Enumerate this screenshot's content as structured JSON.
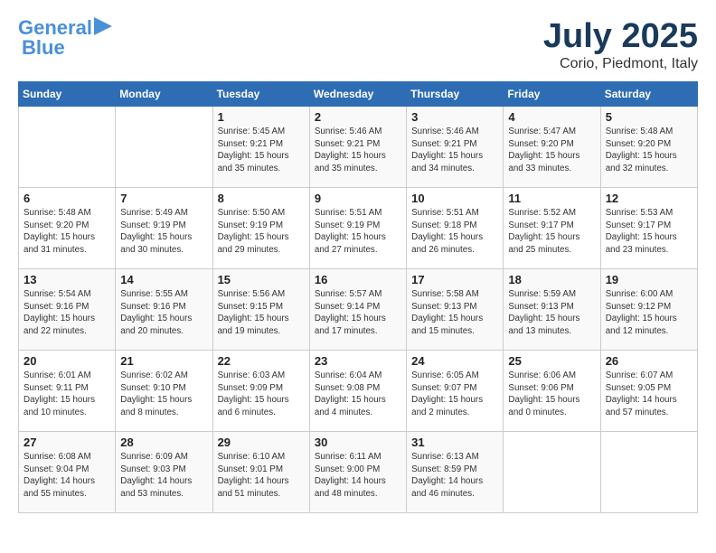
{
  "header": {
    "logo_line1": "General",
    "logo_line2": "Blue",
    "month_title": "July 2025",
    "location": "Corio, Piedmont, Italy"
  },
  "weekdays": [
    "Sunday",
    "Monday",
    "Tuesday",
    "Wednesday",
    "Thursday",
    "Friday",
    "Saturday"
  ],
  "weeks": [
    [
      {
        "day": "",
        "info": ""
      },
      {
        "day": "",
        "info": ""
      },
      {
        "day": "1",
        "info": "Sunrise: 5:45 AM\nSunset: 9:21 PM\nDaylight: 15 hours and 35 minutes."
      },
      {
        "day": "2",
        "info": "Sunrise: 5:46 AM\nSunset: 9:21 PM\nDaylight: 15 hours and 35 minutes."
      },
      {
        "day": "3",
        "info": "Sunrise: 5:46 AM\nSunset: 9:21 PM\nDaylight: 15 hours and 34 minutes."
      },
      {
        "day": "4",
        "info": "Sunrise: 5:47 AM\nSunset: 9:20 PM\nDaylight: 15 hours and 33 minutes."
      },
      {
        "day": "5",
        "info": "Sunrise: 5:48 AM\nSunset: 9:20 PM\nDaylight: 15 hours and 32 minutes."
      }
    ],
    [
      {
        "day": "6",
        "info": "Sunrise: 5:48 AM\nSunset: 9:20 PM\nDaylight: 15 hours and 31 minutes."
      },
      {
        "day": "7",
        "info": "Sunrise: 5:49 AM\nSunset: 9:19 PM\nDaylight: 15 hours and 30 minutes."
      },
      {
        "day": "8",
        "info": "Sunrise: 5:50 AM\nSunset: 9:19 PM\nDaylight: 15 hours and 29 minutes."
      },
      {
        "day": "9",
        "info": "Sunrise: 5:51 AM\nSunset: 9:19 PM\nDaylight: 15 hours and 27 minutes."
      },
      {
        "day": "10",
        "info": "Sunrise: 5:51 AM\nSunset: 9:18 PM\nDaylight: 15 hours and 26 minutes."
      },
      {
        "day": "11",
        "info": "Sunrise: 5:52 AM\nSunset: 9:17 PM\nDaylight: 15 hours and 25 minutes."
      },
      {
        "day": "12",
        "info": "Sunrise: 5:53 AM\nSunset: 9:17 PM\nDaylight: 15 hours and 23 minutes."
      }
    ],
    [
      {
        "day": "13",
        "info": "Sunrise: 5:54 AM\nSunset: 9:16 PM\nDaylight: 15 hours and 22 minutes."
      },
      {
        "day": "14",
        "info": "Sunrise: 5:55 AM\nSunset: 9:16 PM\nDaylight: 15 hours and 20 minutes."
      },
      {
        "day": "15",
        "info": "Sunrise: 5:56 AM\nSunset: 9:15 PM\nDaylight: 15 hours and 19 minutes."
      },
      {
        "day": "16",
        "info": "Sunrise: 5:57 AM\nSunset: 9:14 PM\nDaylight: 15 hours and 17 minutes."
      },
      {
        "day": "17",
        "info": "Sunrise: 5:58 AM\nSunset: 9:13 PM\nDaylight: 15 hours and 15 minutes."
      },
      {
        "day": "18",
        "info": "Sunrise: 5:59 AM\nSunset: 9:13 PM\nDaylight: 15 hours and 13 minutes."
      },
      {
        "day": "19",
        "info": "Sunrise: 6:00 AM\nSunset: 9:12 PM\nDaylight: 15 hours and 12 minutes."
      }
    ],
    [
      {
        "day": "20",
        "info": "Sunrise: 6:01 AM\nSunset: 9:11 PM\nDaylight: 15 hours and 10 minutes."
      },
      {
        "day": "21",
        "info": "Sunrise: 6:02 AM\nSunset: 9:10 PM\nDaylight: 15 hours and 8 minutes."
      },
      {
        "day": "22",
        "info": "Sunrise: 6:03 AM\nSunset: 9:09 PM\nDaylight: 15 hours and 6 minutes."
      },
      {
        "day": "23",
        "info": "Sunrise: 6:04 AM\nSunset: 9:08 PM\nDaylight: 15 hours and 4 minutes."
      },
      {
        "day": "24",
        "info": "Sunrise: 6:05 AM\nSunset: 9:07 PM\nDaylight: 15 hours and 2 minutes."
      },
      {
        "day": "25",
        "info": "Sunrise: 6:06 AM\nSunset: 9:06 PM\nDaylight: 15 hours and 0 minutes."
      },
      {
        "day": "26",
        "info": "Sunrise: 6:07 AM\nSunset: 9:05 PM\nDaylight: 14 hours and 57 minutes."
      }
    ],
    [
      {
        "day": "27",
        "info": "Sunrise: 6:08 AM\nSunset: 9:04 PM\nDaylight: 14 hours and 55 minutes."
      },
      {
        "day": "28",
        "info": "Sunrise: 6:09 AM\nSunset: 9:03 PM\nDaylight: 14 hours and 53 minutes."
      },
      {
        "day": "29",
        "info": "Sunrise: 6:10 AM\nSunset: 9:01 PM\nDaylight: 14 hours and 51 minutes."
      },
      {
        "day": "30",
        "info": "Sunrise: 6:11 AM\nSunset: 9:00 PM\nDaylight: 14 hours and 48 minutes."
      },
      {
        "day": "31",
        "info": "Sunrise: 6:13 AM\nSunset: 8:59 PM\nDaylight: 14 hours and 46 minutes."
      },
      {
        "day": "",
        "info": ""
      },
      {
        "day": "",
        "info": ""
      }
    ]
  ]
}
